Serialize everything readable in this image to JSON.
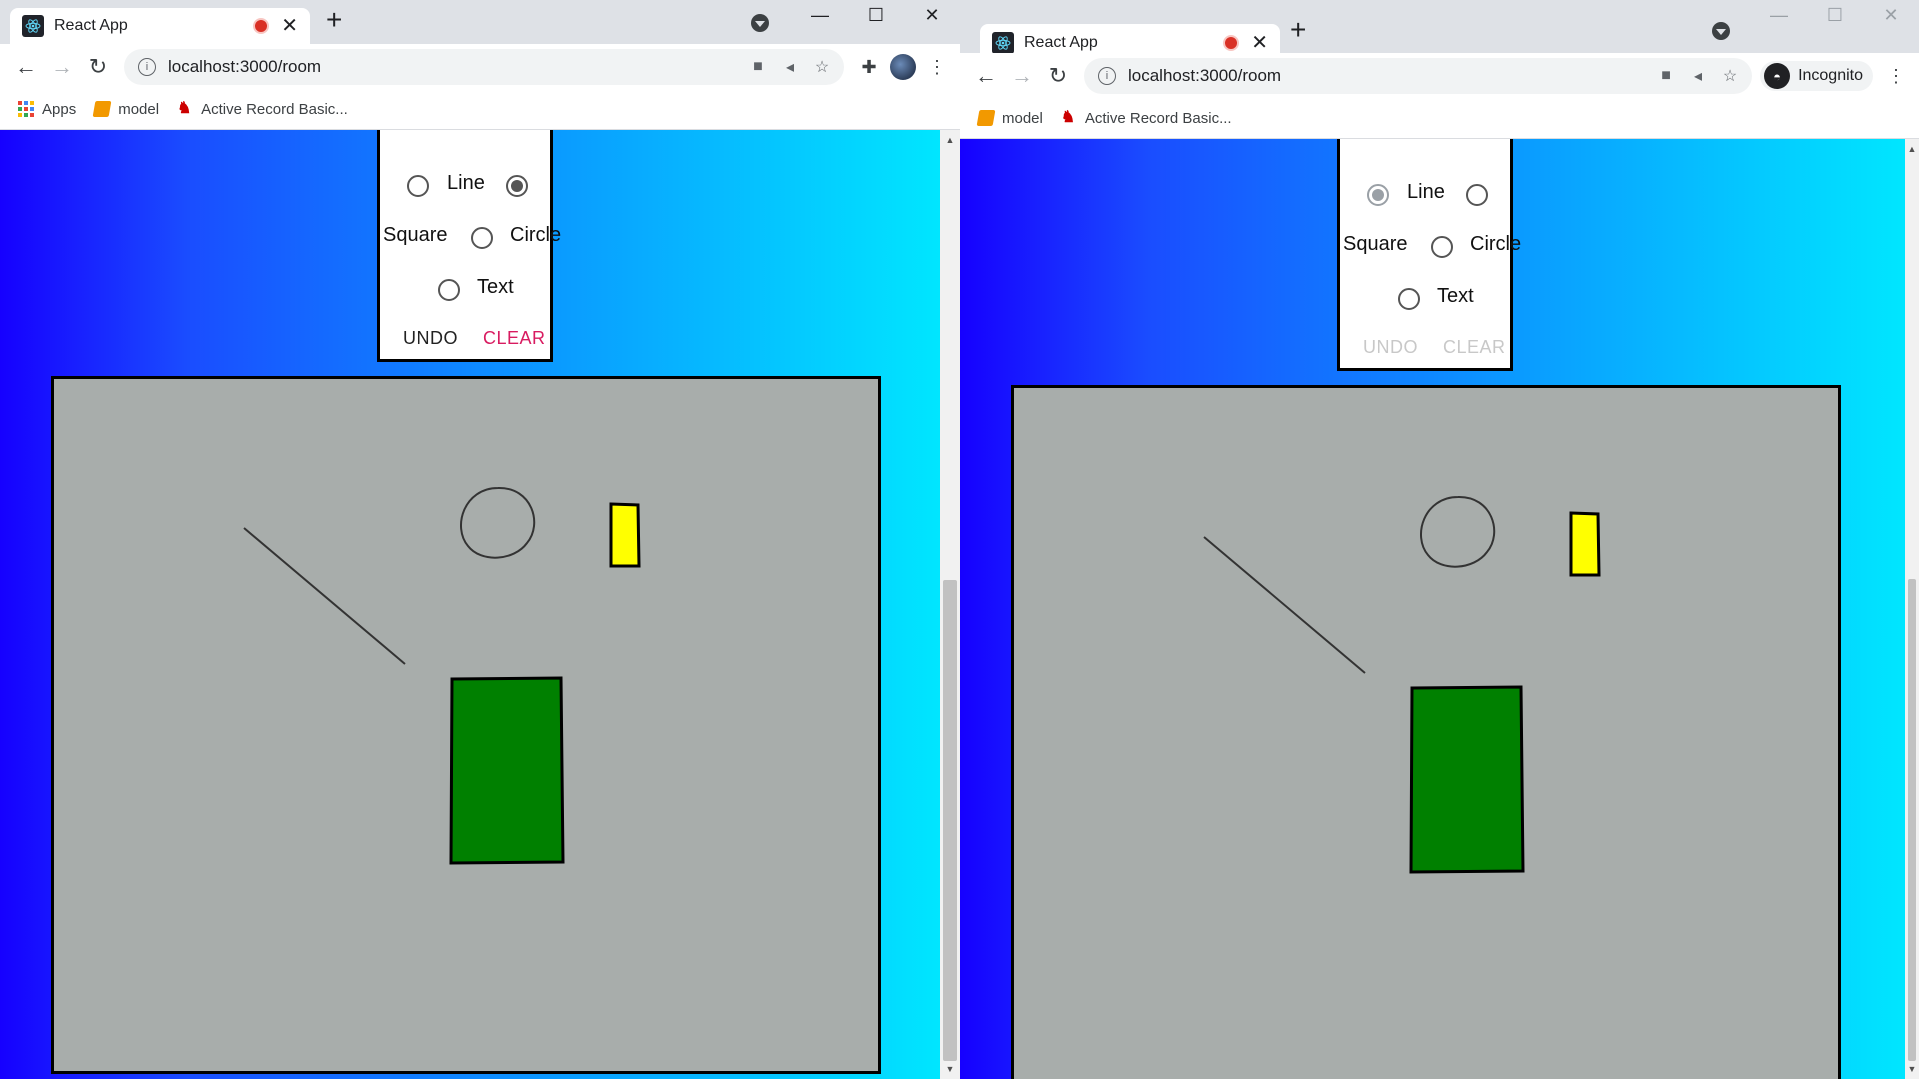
{
  "windows": [
    {
      "tab_title": "React App",
      "url": "localhost:3000/room",
      "bookmarks": [
        "Apps",
        "model",
        "Active Record Basic..."
      ],
      "profile": "avatar",
      "tools": {
        "line": "Line",
        "square": "Square",
        "circle": "Circle",
        "text": "Text",
        "selected": "square",
        "undo": "UNDO",
        "clear": "CLEAR",
        "buttons_enabled": true
      }
    },
    {
      "tab_title": "React App",
      "url": "localhost:3000/room",
      "bookmarks": [
        "model",
        "Active Record Basic..."
      ],
      "profile": "Incognito",
      "tools": {
        "line": "Line",
        "square": "Square",
        "circle": "Circle",
        "text": "Text",
        "selected": "line",
        "undo": "UNDO",
        "clear": "CLEAR",
        "buttons_enabled": false
      }
    }
  ],
  "canvas_shapes": [
    {
      "kind": "line",
      "color": "#333333"
    },
    {
      "kind": "circle",
      "color": "#333333"
    },
    {
      "kind": "rect",
      "fill": "#ffff00",
      "stroke": "#000000"
    },
    {
      "kind": "rect",
      "fill": "#008000",
      "stroke": "#000000"
    }
  ],
  "colors": {
    "gradient_start": "#1600ff",
    "gradient_end": "#00e6ff",
    "canvas_bg": "#a8adab",
    "clear_accent": "#d81b60"
  }
}
